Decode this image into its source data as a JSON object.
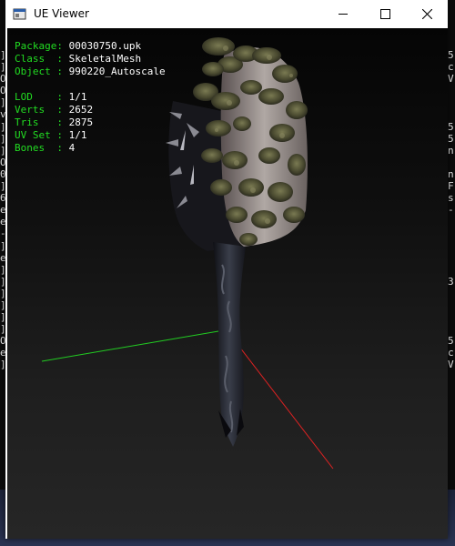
{
  "window": {
    "title": "UE Viewer",
    "icons": {
      "app": "ue-viewer-app-icon",
      "minimize": "minimize-icon",
      "maximize": "maximize-icon",
      "close": "close-icon"
    }
  },
  "info_panel": {
    "object_info": [
      {
        "key": "Package:",
        "value": "00030750.upk"
      },
      {
        "key": "Class  :",
        "value": "SkeletalMesh"
      },
      {
        "key": "Object :",
        "value": "990220_Autoscale"
      }
    ],
    "mesh_stats": [
      {
        "key": "LOD    :",
        "value": "1/1"
      },
      {
        "key": "Verts  :",
        "value": "2652"
      },
      {
        "key": "Tris   :",
        "value": "2875"
      },
      {
        "key": "UV Set :",
        "value": "1/1"
      },
      {
        "key": "Bones  :",
        "value": "4"
      }
    ]
  },
  "viewport": {
    "axis_colors": {
      "x_axis": "#22cc22",
      "y_axis": "#dd2222"
    },
    "mesh_description": "skeletal mesh preview",
    "background_top": "#050505",
    "background_bottom": "#262626"
  },
  "background_console": {
    "left_glyphs": "]\n]\nO\nO\n]\nv\n]\n]\n]\nO\n0\n]\n6\ne\ne\n-\n]\ne\n]\n]\n]\n]\n]\n]\nO\ne\n]",
    "right_glyphs": "5\nc\nV\n\n\n\n5\n5\nn\n\nn\nF\ns\n-\n\n\n\n\n\n3\n\n\n\n\n5\nc\nV"
  }
}
